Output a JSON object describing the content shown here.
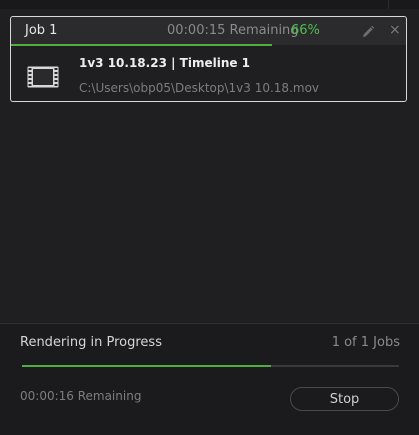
{
  "job": {
    "title": "Job 1",
    "remaining": "00:00:15 Remaining",
    "percent": "66%",
    "progress": 0.66,
    "clip_name": "1v3 10.18.23 | Timeline 1",
    "clip_path": "C:\\Users\\obp05\\Desktop\\1v3 10.18.mov",
    "icons": {
      "edit": "pencil-icon",
      "close": "close-icon",
      "clip": "film-strip-icon"
    },
    "close_glyph": "×"
  },
  "render": {
    "status": "Rendering in Progress",
    "jobs_count": "1 of 1 Jobs",
    "progress": 0.66,
    "remaining": "00:00:16 Remaining",
    "stop_label": "Stop"
  },
  "colors": {
    "accent_green": "#4fae3f",
    "percent_green": "#4fbe4f",
    "background": "#1f1f22",
    "card_border": "#d8d8d8"
  }
}
